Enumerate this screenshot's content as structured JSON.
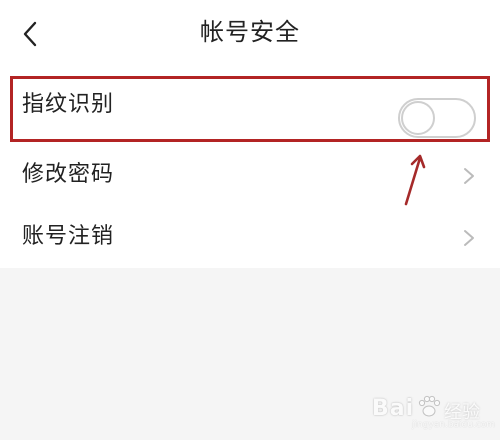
{
  "header": {
    "title": "帐号安全"
  },
  "settings": {
    "items": [
      {
        "label": "指纹识别",
        "control": "toggle",
        "enabled": false
      },
      {
        "label": "修改密码",
        "control": "chevron"
      },
      {
        "label": "账号注销",
        "control": "chevron"
      }
    ]
  },
  "annotation": {
    "box_color": "#b32424",
    "arrow_color": "#a52a2a"
  },
  "watermark": {
    "text_a": "Bai",
    "text_b": "经验",
    "sub": "jingyan.baidu.com"
  },
  "colors": {
    "background": "#f5f5f5",
    "card": "#ffffff",
    "text": "#222222",
    "toggle_border": "#cfcfcf",
    "chevron": "#bbbbbb"
  },
  "icons": {
    "back": "back-arrow-icon",
    "chevron": "chevron-right-icon",
    "arrow": "annotation-arrow-icon",
    "paw": "paw-icon"
  }
}
